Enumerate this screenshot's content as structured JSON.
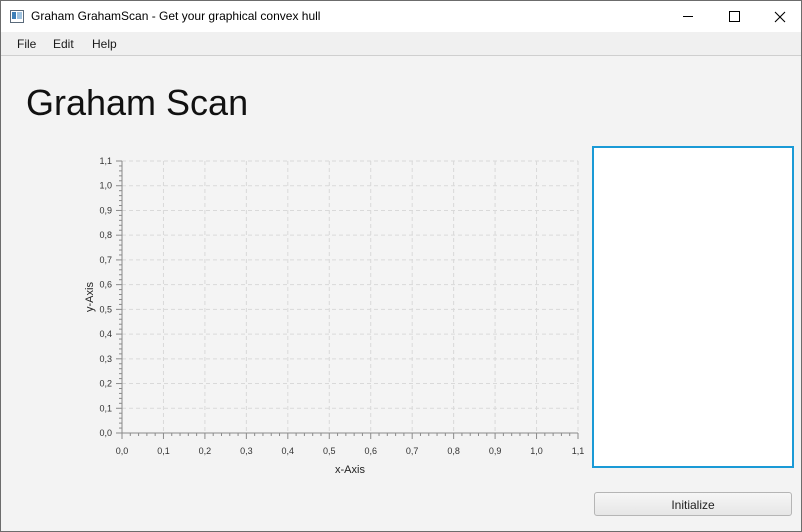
{
  "window": {
    "title": "Graham GrahamScan - Get your graphical convex hull",
    "icon": "app-window-icon"
  },
  "menu": {
    "items": [
      "File",
      "Edit",
      "Help"
    ]
  },
  "page": {
    "heading": "Graham Scan"
  },
  "chart_data": {
    "type": "scatter",
    "title": "",
    "xlabel": "x-Axis",
    "ylabel": "y-Axis",
    "xlim": [
      0,
      1.1
    ],
    "ylim": [
      0,
      1.1
    ],
    "x_ticks": [
      "0,0",
      "0,1",
      "0,2",
      "0,3",
      "0,4",
      "0,5",
      "0,6",
      "0,7",
      "0,8",
      "0,9",
      "1,0",
      "1,1"
    ],
    "y_ticks": [
      "0,0",
      "0,1",
      "0,2",
      "0,3",
      "0,4",
      "0,5",
      "0,6",
      "0,7",
      "0,8",
      "0,9",
      "1,0",
      "1,1"
    ],
    "grid": true,
    "grid_style": "dashed",
    "series": []
  },
  "controls": {
    "initialize_label": "Initialize"
  },
  "colors": {
    "panel_border": "#1a9ad6",
    "background": "#f3f3f3"
  }
}
